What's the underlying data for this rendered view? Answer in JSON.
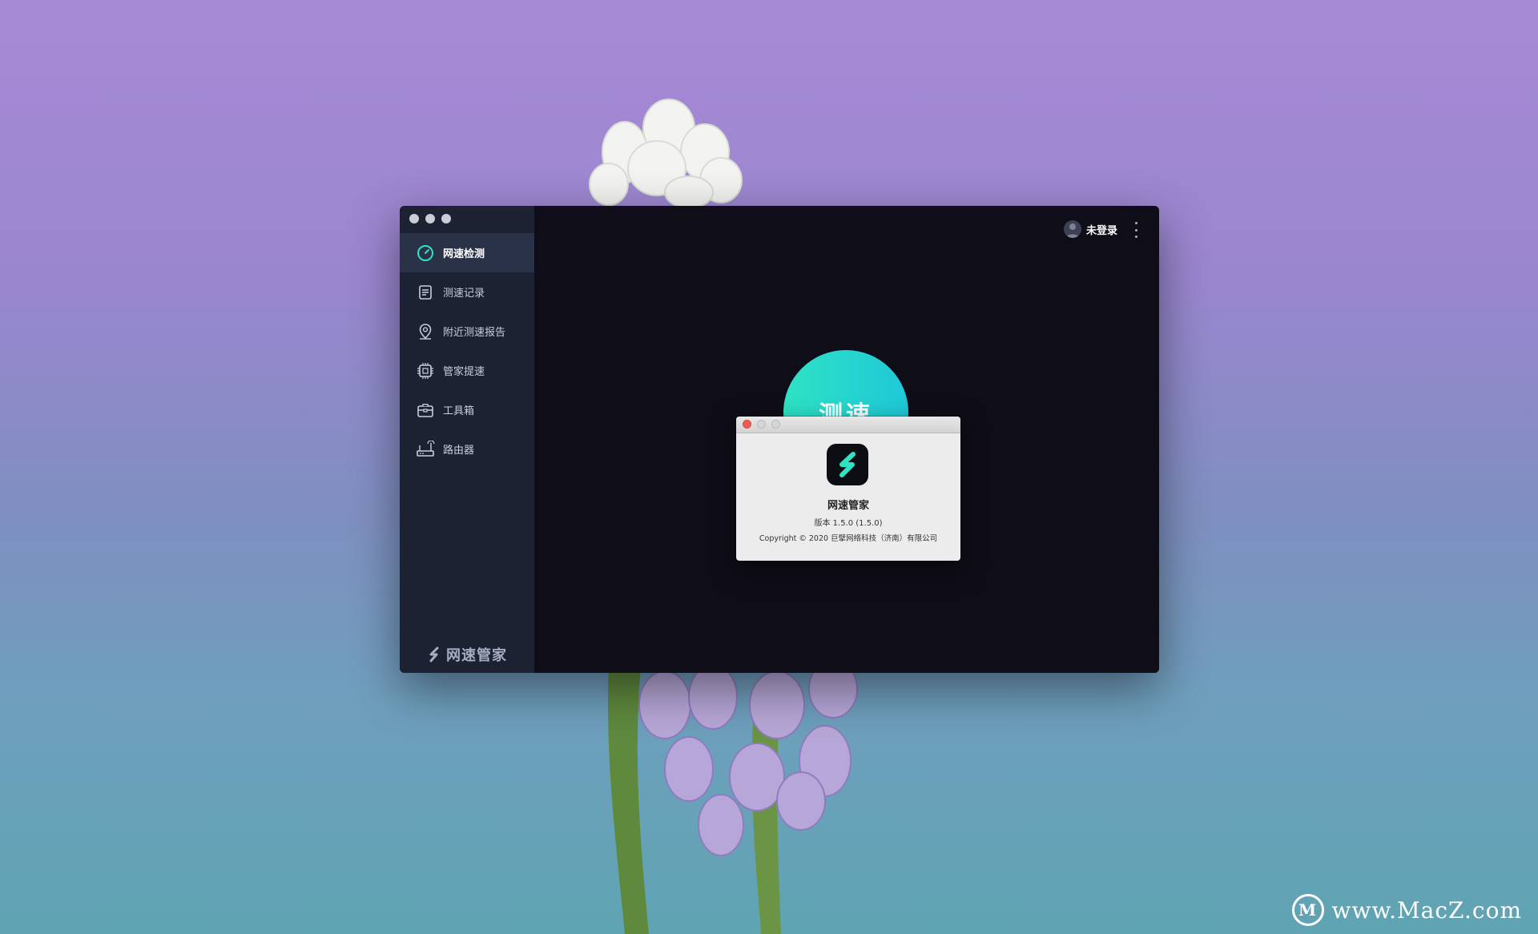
{
  "sidebar": {
    "items": [
      {
        "label": "网速检测",
        "icon": "speedometer-icon",
        "active": true
      },
      {
        "label": "测速记录",
        "icon": "document-icon",
        "active": false
      },
      {
        "label": "附近测速报告",
        "icon": "location-pin-icon",
        "active": false
      },
      {
        "label": "管家提速",
        "icon": "chip-icon",
        "active": false
      },
      {
        "label": "工具箱",
        "icon": "toolbox-icon",
        "active": false
      },
      {
        "label": "路由器",
        "icon": "router-icon",
        "active": false
      }
    ],
    "brand": "网速管家"
  },
  "header": {
    "account_label": "未登录"
  },
  "main": {
    "speed_button_label": "测速"
  },
  "about_dialog": {
    "app_name": "网速管家",
    "version": "版本 1.5.0 (1.5.0)",
    "copyright": "Copyright © 2020 巨擘网络科技（济南）有限公司"
  },
  "watermark": {
    "text": "www.MacZ.com",
    "logo_letter": "M"
  },
  "colors": {
    "accent": "#2ee3c4",
    "sidebar_bg": "#1d2232",
    "main_bg": "#0f0d17",
    "dialog_close": "#ee5b52"
  }
}
